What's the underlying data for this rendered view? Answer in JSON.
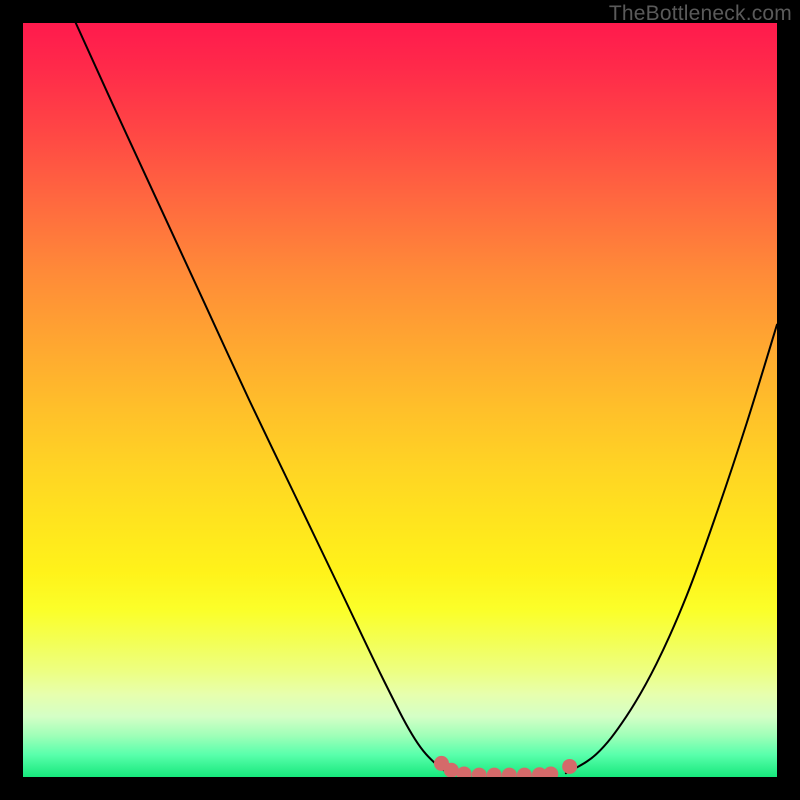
{
  "watermark": "TheBottleneck.com",
  "colors": {
    "frame": "#000000",
    "curve": "#000000",
    "marker_fill": "#d46a6a",
    "marker_stroke": "#c85a5a"
  },
  "chart_data": {
    "type": "line",
    "title": "",
    "xlabel": "",
    "ylabel": "",
    "xlim": [
      0,
      100
    ],
    "ylim": [
      0,
      100
    ],
    "grid": false,
    "legend": false,
    "series": [
      {
        "name": "left-curve",
        "x": [
          7,
          12,
          18,
          24,
          30,
          36,
          42,
          48,
          52,
          55,
          57
        ],
        "values": [
          100,
          89,
          76,
          63,
          50,
          37.5,
          25,
          12.5,
          5,
          1.5,
          0.3
        ]
      },
      {
        "name": "right-curve",
        "x": [
          72,
          76,
          80,
          84,
          88,
          92,
          96,
          100
        ],
        "values": [
          0.5,
          3,
          8,
          15,
          24,
          35,
          47,
          60
        ]
      }
    ],
    "markers": [
      {
        "x": 55.5,
        "y": 1.8
      },
      {
        "x": 56.8,
        "y": 0.9
      },
      {
        "x": 58.5,
        "y": 0.4
      },
      {
        "x": 60.5,
        "y": 0.25
      },
      {
        "x": 62.5,
        "y": 0.25
      },
      {
        "x": 64.5,
        "y": 0.25
      },
      {
        "x": 66.5,
        "y": 0.25
      },
      {
        "x": 68.5,
        "y": 0.3
      },
      {
        "x": 70.0,
        "y": 0.4
      },
      {
        "x": 72.5,
        "y": 1.4
      }
    ],
    "annotations": []
  }
}
